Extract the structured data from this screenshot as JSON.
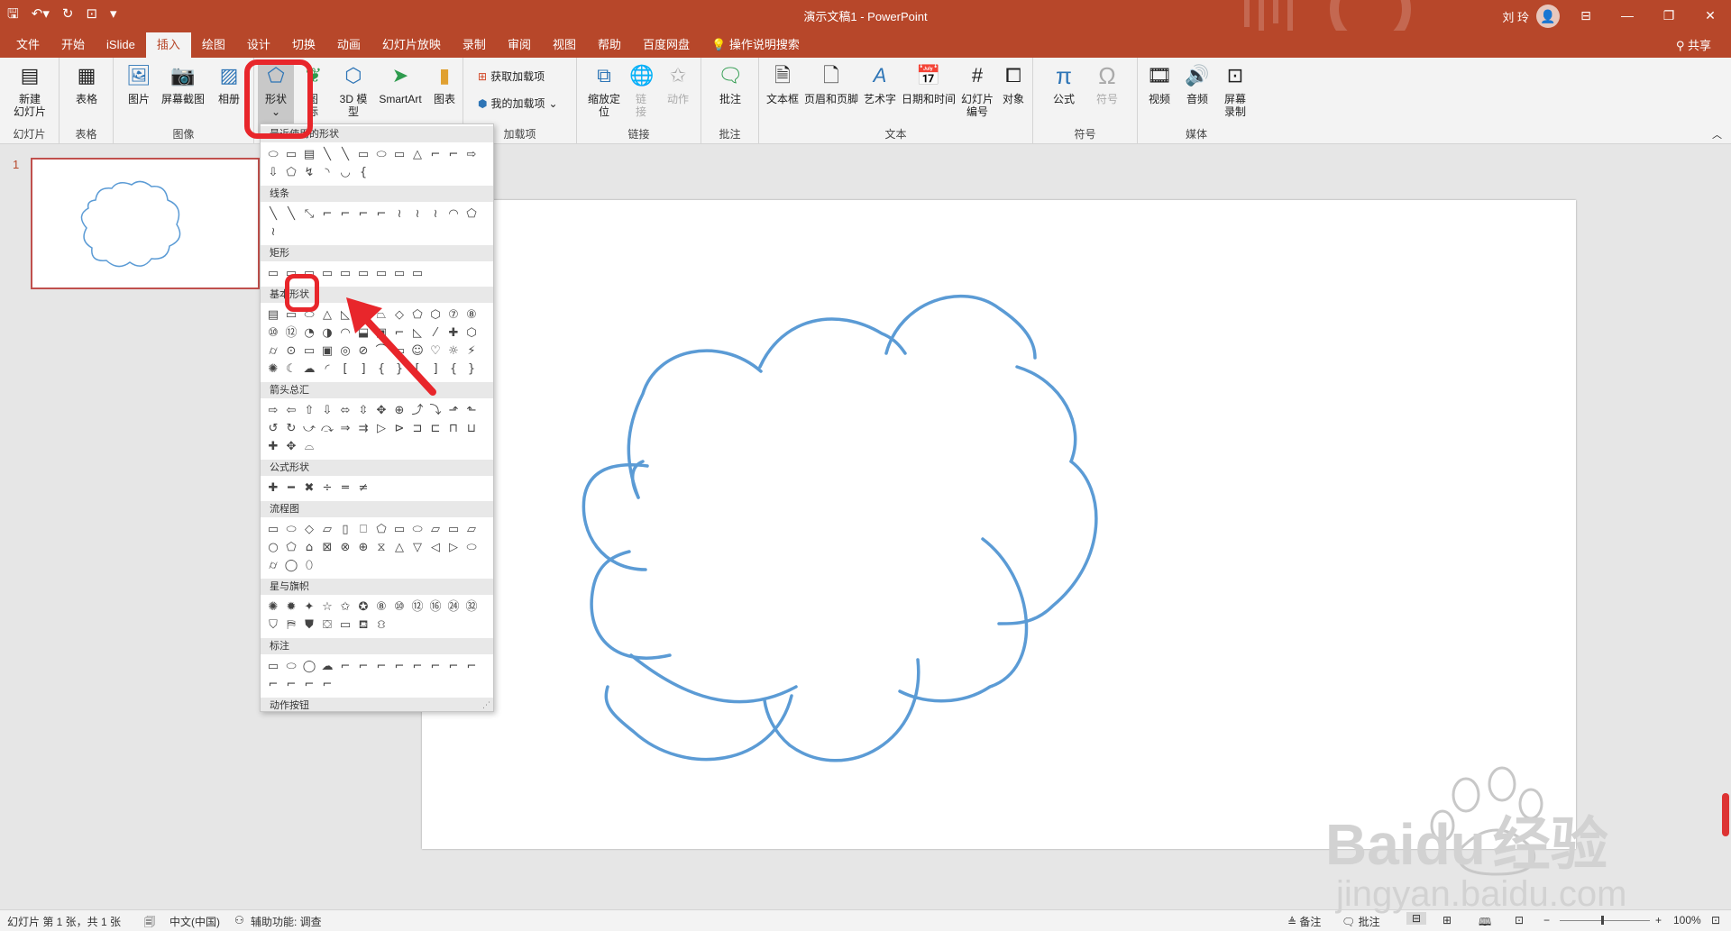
{
  "titlebar": {
    "doc_title": "演示文稿1  -  PowerPoint",
    "user": "刘 玲",
    "quick_access": [
      "save-icon",
      "undo-icon",
      "redo-icon",
      "present-icon",
      "customize-icon"
    ]
  },
  "tabs": [
    "文件",
    "开始",
    "iSlide",
    "插入",
    "绘图",
    "设计",
    "切换",
    "动画",
    "幻灯片放映",
    "录制",
    "审阅",
    "视图",
    "帮助",
    "百度网盘"
  ],
  "active_tab": "插入",
  "tell_me": "操作说明搜索",
  "share": "共享",
  "ribbon": {
    "new_slide": "新建\n幻灯片",
    "table": "表格",
    "pictures": "图片",
    "screenshot": "屏幕截图",
    "album": "相册",
    "shapes": "形状",
    "icons": "图\n标",
    "model3d": "3D 模\n型",
    "smartart": "SmartArt",
    "chart": "图表",
    "get_addins": "获取加载项",
    "my_addins": "我的加载项",
    "zoom": "缩放定\n位",
    "link": "链\n接",
    "action": "动作",
    "comment": "批注",
    "textbox": "文本框",
    "header_footer": "页眉和页脚",
    "wordart": "艺术字",
    "datetime": "日期和时间",
    "slide_number": "幻灯片\n编号",
    "object": "对象",
    "equation": "公式",
    "symbol": "符号",
    "video": "视频",
    "audio": "音频",
    "screen_recording": "屏幕\n录制",
    "groups": {
      "slides": "幻灯片",
      "tables": "表格",
      "images": "图像",
      "addins": "加载项",
      "links": "链接",
      "comments": "批注",
      "text": "文本",
      "symbols": "符号",
      "media": "媒体"
    }
  },
  "dropdown": {
    "sections": [
      {
        "title": "最近使用的形状",
        "glyphs": "⬭▭▤╲╲▭⬭▭△⌐⌐⇨⇩⬠↯◝◡{"
      },
      {
        "title": "线条",
        "glyphs": "╲╲⤡⌐⌐⌐⌐≀≀≀◠⬠≀"
      },
      {
        "title": "矩形",
        "glyphs": "▭▭▭▭▭▭▭▭▭"
      },
      {
        "title": "基本形状",
        "glyphs": "▤▭⬭△◺▱⏢◇⬠⬡⑦⑧⑩⑫◔◑◠⬓▣⌐◺⁄✚⬡⌭⊙▭▣◎⊘⌒▭☺♡☼⚡✺☾☁◜[]{}[]{}"
      },
      {
        "title": "箭头总汇",
        "glyphs": "⇨⇦⇧⇩⬄⇳✥⊕⤴⤵⬏⬑↺↻⤻⤼⇒⇉▷⊳⊐⊏⊓⊔✚✥⌓"
      },
      {
        "title": "公式形状",
        "glyphs": "✚━✖÷═≠"
      },
      {
        "title": "流程图",
        "glyphs": "▭⬭◇▱▯⎕⬠▭⬭▱▭⏥○⬠⌂⊠⊗⊕⧖△▽◁▷⬭⌭◯⬯"
      },
      {
        "title": "星与旗帜",
        "glyphs": "✺✹✦☆✩✪⑧⑩⑫⑯㉔㉜⛉⛿⛊⛋▭⛾⛻"
      },
      {
        "title": "标注",
        "glyphs": "▭⬭◯☁⌐⌐⌐⌐⌐⌐⌐⌐⌐⌐⌐⌐"
      },
      {
        "title": "动作按钮",
        "glyphs": "◁▷⏮⏭⌂ⓘ↩▶▤♪?▭"
      }
    ]
  },
  "slide_panel": {
    "number": "1"
  },
  "status": {
    "slide_info": "幻灯片 第 1 张，共 1 张",
    "language": "中文(中国)",
    "accessibility": "辅助功能: 调查",
    "notes": "备注",
    "comments": "批注",
    "zoom": "100%"
  },
  "watermark": {
    "brand": "Baidu",
    "cn": "经验",
    "url": "jingyan.baidu.com"
  },
  "colors": {
    "accent": "#b7472a",
    "cloud_stroke": "#5b9bd5",
    "highlight": "#e8262b"
  }
}
